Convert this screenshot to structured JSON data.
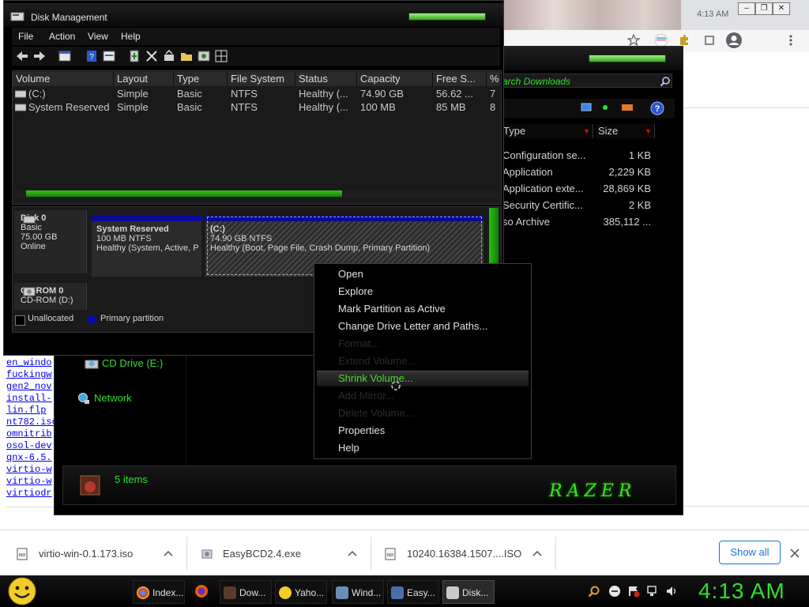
{
  "disk_management": {
    "title": "Disk Management",
    "menu": [
      "File",
      "Action",
      "View",
      "Help"
    ],
    "columns": [
      "Volume",
      "Layout",
      "Type",
      "File System",
      "Status",
      "Capacity",
      "Free S...",
      "%"
    ],
    "volumes": [
      {
        "volume": "(C:)",
        "layout": "Simple",
        "type": "Basic",
        "fs": "NTFS",
        "status": "Healthy (...",
        "capacity": "74.90 GB",
        "free": "56.62 ...",
        "pct": "7"
      },
      {
        "volume": "System Reserved",
        "layout": "Simple",
        "type": "Basic",
        "fs": "NTFS",
        "status": "Healthy (...",
        "capacity": "100 MB",
        "free": "85 MB",
        "pct": "8"
      }
    ],
    "disks": [
      {
        "name": "Disk 0",
        "kind": "Basic",
        "size": "75.00 GB",
        "state": "Online"
      },
      {
        "name": "CD-ROM 0",
        "kind": "CD-ROM (D:)"
      }
    ],
    "partitions": [
      {
        "name": "System Reserved",
        "size": "100 MB NTFS",
        "status": "Healthy (System, Active, P"
      },
      {
        "name": "(C:)",
        "size": "74.90 GB NTFS",
        "status": "Healthy (Boot, Page File, Crash Dump, Primary Partition)"
      }
    ],
    "legend": [
      "Unallocated",
      "Primary partition"
    ]
  },
  "context_menu": {
    "items": [
      {
        "label": "Open",
        "enabled": true
      },
      {
        "label": "Explore",
        "enabled": true
      },
      {
        "label": "Mark Partition as Active",
        "enabled": true
      },
      {
        "label": "Change Drive Letter and Paths...",
        "enabled": true
      },
      {
        "label": "Format...",
        "enabled": false
      },
      {
        "label": "Extend Volume...",
        "enabled": false
      },
      {
        "label": "Shrink Volume...",
        "enabled": true,
        "highlighted": true
      },
      {
        "label": "Add Mirror...",
        "enabled": false
      },
      {
        "label": "Delete Volume...",
        "enabled": false
      },
      {
        "label": "Properties",
        "enabled": true
      },
      {
        "label": "Help",
        "enabled": true
      }
    ]
  },
  "explorer": {
    "search_placeholder": "arch Downloads",
    "columns": [
      "Type",
      "Size"
    ],
    "files": [
      {
        "type": "Configuration se...",
        "size": "1 KB"
      },
      {
        "type": "Application",
        "size": "2,229 KB"
      },
      {
        "type": "Application exte...",
        "size": "28,869 KB"
      },
      {
        "type": "Security Certific...",
        "size": "2 KB"
      },
      {
        "type": "so Archive",
        "size": "385,112 ..."
      }
    ],
    "nav": [
      "CD Drive (E:)",
      "Network"
    ],
    "status": "5 items",
    "logo": "RAZER",
    "accent": "#2ee02e"
  },
  "browser_files": [
    "en_windo",
    "fuckingw",
    "gen2_nov",
    "install-",
    "lin.flp",
    "nt782.iso",
    "omnitrib",
    "osol-dev",
    "qnx-6.5.",
    "virtio-w",
    "virtio-w",
    "virtiodr"
  ],
  "downloads": {
    "items": [
      "virtio-win-0.1.173.iso",
      "EasyBCD2.4.exe",
      "10240.16384.1507....ISO"
    ],
    "show_all": "Show all"
  },
  "taskbar": {
    "buttons": [
      "Index...",
      "Dow...",
      "Yaho...",
      "Wind...",
      "Easy...",
      "Disk..."
    ],
    "clock": "4:13 AM"
  },
  "chrome": {
    "clock": "4:13 AM"
  }
}
